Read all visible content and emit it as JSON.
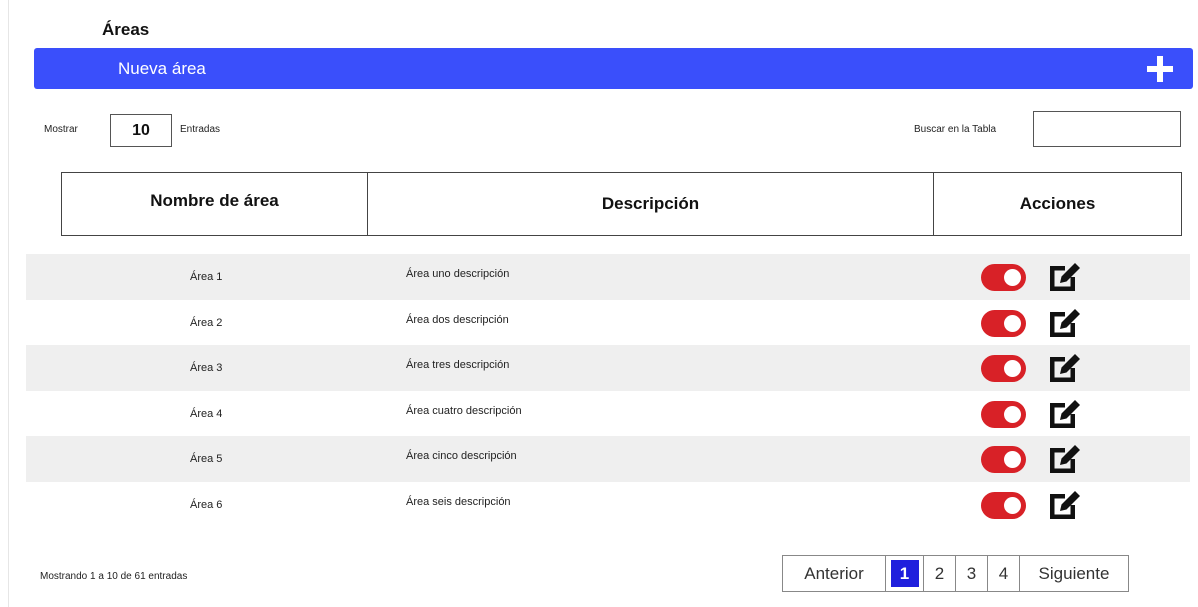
{
  "page": {
    "title": "Áreas"
  },
  "banner": {
    "label": "Nueva área",
    "add_icon": "plus-icon"
  },
  "controls": {
    "show_label": "Mostrar",
    "show_value": "10",
    "entries_label": "Entradas",
    "search_label": "Buscar en la Tabla",
    "search_value": ""
  },
  "table": {
    "headers": [
      "Nombre de área",
      "Descripción",
      "Acciones"
    ],
    "rows": [
      {
        "name": "Área 1",
        "description": "Área uno descripción",
        "active": true
      },
      {
        "name": "Área 2",
        "description": "Área dos descripción",
        "active": true
      },
      {
        "name": "Área 3",
        "description": "Área tres descripción",
        "active": true
      },
      {
        "name": "Área 4",
        "description": "Área cuatro descripción",
        "active": true
      },
      {
        "name": "Área 5",
        "description": "Área cinco descripción",
        "active": true
      },
      {
        "name": "Área 6",
        "description": "Área seis descripción",
        "active": true
      }
    ]
  },
  "footer": {
    "info": "Mostrando 1 a 10 de 61 entradas",
    "pagination": {
      "prev": "Anterior",
      "pages": [
        "1",
        "2",
        "3",
        "4"
      ],
      "current": "1",
      "next": "Siguiente"
    }
  },
  "colors": {
    "banner": "#3a4ffb",
    "toggle_on": "#d82127",
    "active_page": "#1f1fdd",
    "row_shade": "#efefef"
  },
  "icons": {
    "toggle": "toggle-switch-icon",
    "edit": "edit-icon"
  }
}
